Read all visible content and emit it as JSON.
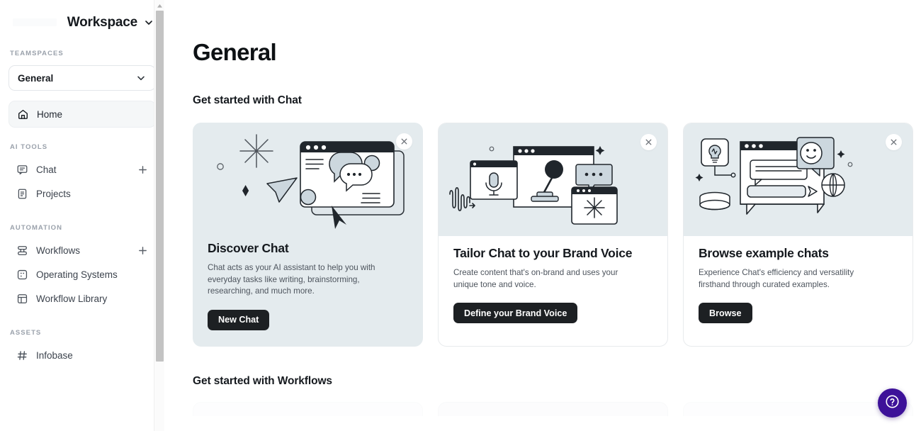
{
  "sidebar": {
    "workspace_title": "Workspace",
    "workspace_chevron_icon": "chevron-down-icon",
    "teamspaces_label": "Teamspaces",
    "teamspace_selected": "General",
    "teamspace_chevron_icon": "chevron-down-icon",
    "home": {
      "label": "Home",
      "icon": "home-icon"
    },
    "groups": [
      {
        "label": "AI Tools",
        "items": [
          {
            "label": "Chat",
            "icon": "chat-bubble-icon",
            "action_icon": "plus-icon"
          },
          {
            "label": "Projects",
            "icon": "document-icon",
            "action_icon": ""
          }
        ]
      },
      {
        "label": "Automation",
        "items": [
          {
            "label": "Workflows",
            "icon": "workflow-stack-icon",
            "action_icon": "plus-icon"
          },
          {
            "label": "Operating Systems",
            "icon": "operating-system-icon",
            "action_icon": ""
          },
          {
            "label": "Workflow Library",
            "icon": "layout-panel-icon",
            "action_icon": ""
          }
        ]
      },
      {
        "label": "Assets",
        "items": [
          {
            "label": "Infobase",
            "icon": "hash-icon",
            "action_icon": ""
          }
        ]
      }
    ],
    "scrollbar": {
      "arrow_up_icon": "triangle-up-icon"
    }
  },
  "main": {
    "page_title": "General",
    "sections": [
      {
        "heading": "Get started with Chat"
      },
      {
        "heading": "Get started with Workflows"
      }
    ],
    "cards": [
      {
        "title": "Discover Chat",
        "description": "Chat acts as your AI assistant to help you with everyday tasks like writing, brainstorming, researching, and much more.",
        "button": "New Chat",
        "close_icon": "close-icon",
        "illustration": "chat-window-bubbles-illustration"
      },
      {
        "title": "Tailor Chat to your Brand Voice",
        "description": "Create content that's on-brand and uses your unique tone and voice.",
        "button": "Define your Brand Voice",
        "close_icon": "close-icon",
        "illustration": "microphone-brand-voice-illustration"
      },
      {
        "title": "Browse example chats",
        "description": "Experience Chat's efficiency and versatility firsthand through curated examples.",
        "button": "Browse",
        "close_icon": "close-icon",
        "illustration": "example-chats-illustration"
      }
    ]
  },
  "help": {
    "icon": "question-mark-circle-icon",
    "color": "#3d1299"
  }
}
